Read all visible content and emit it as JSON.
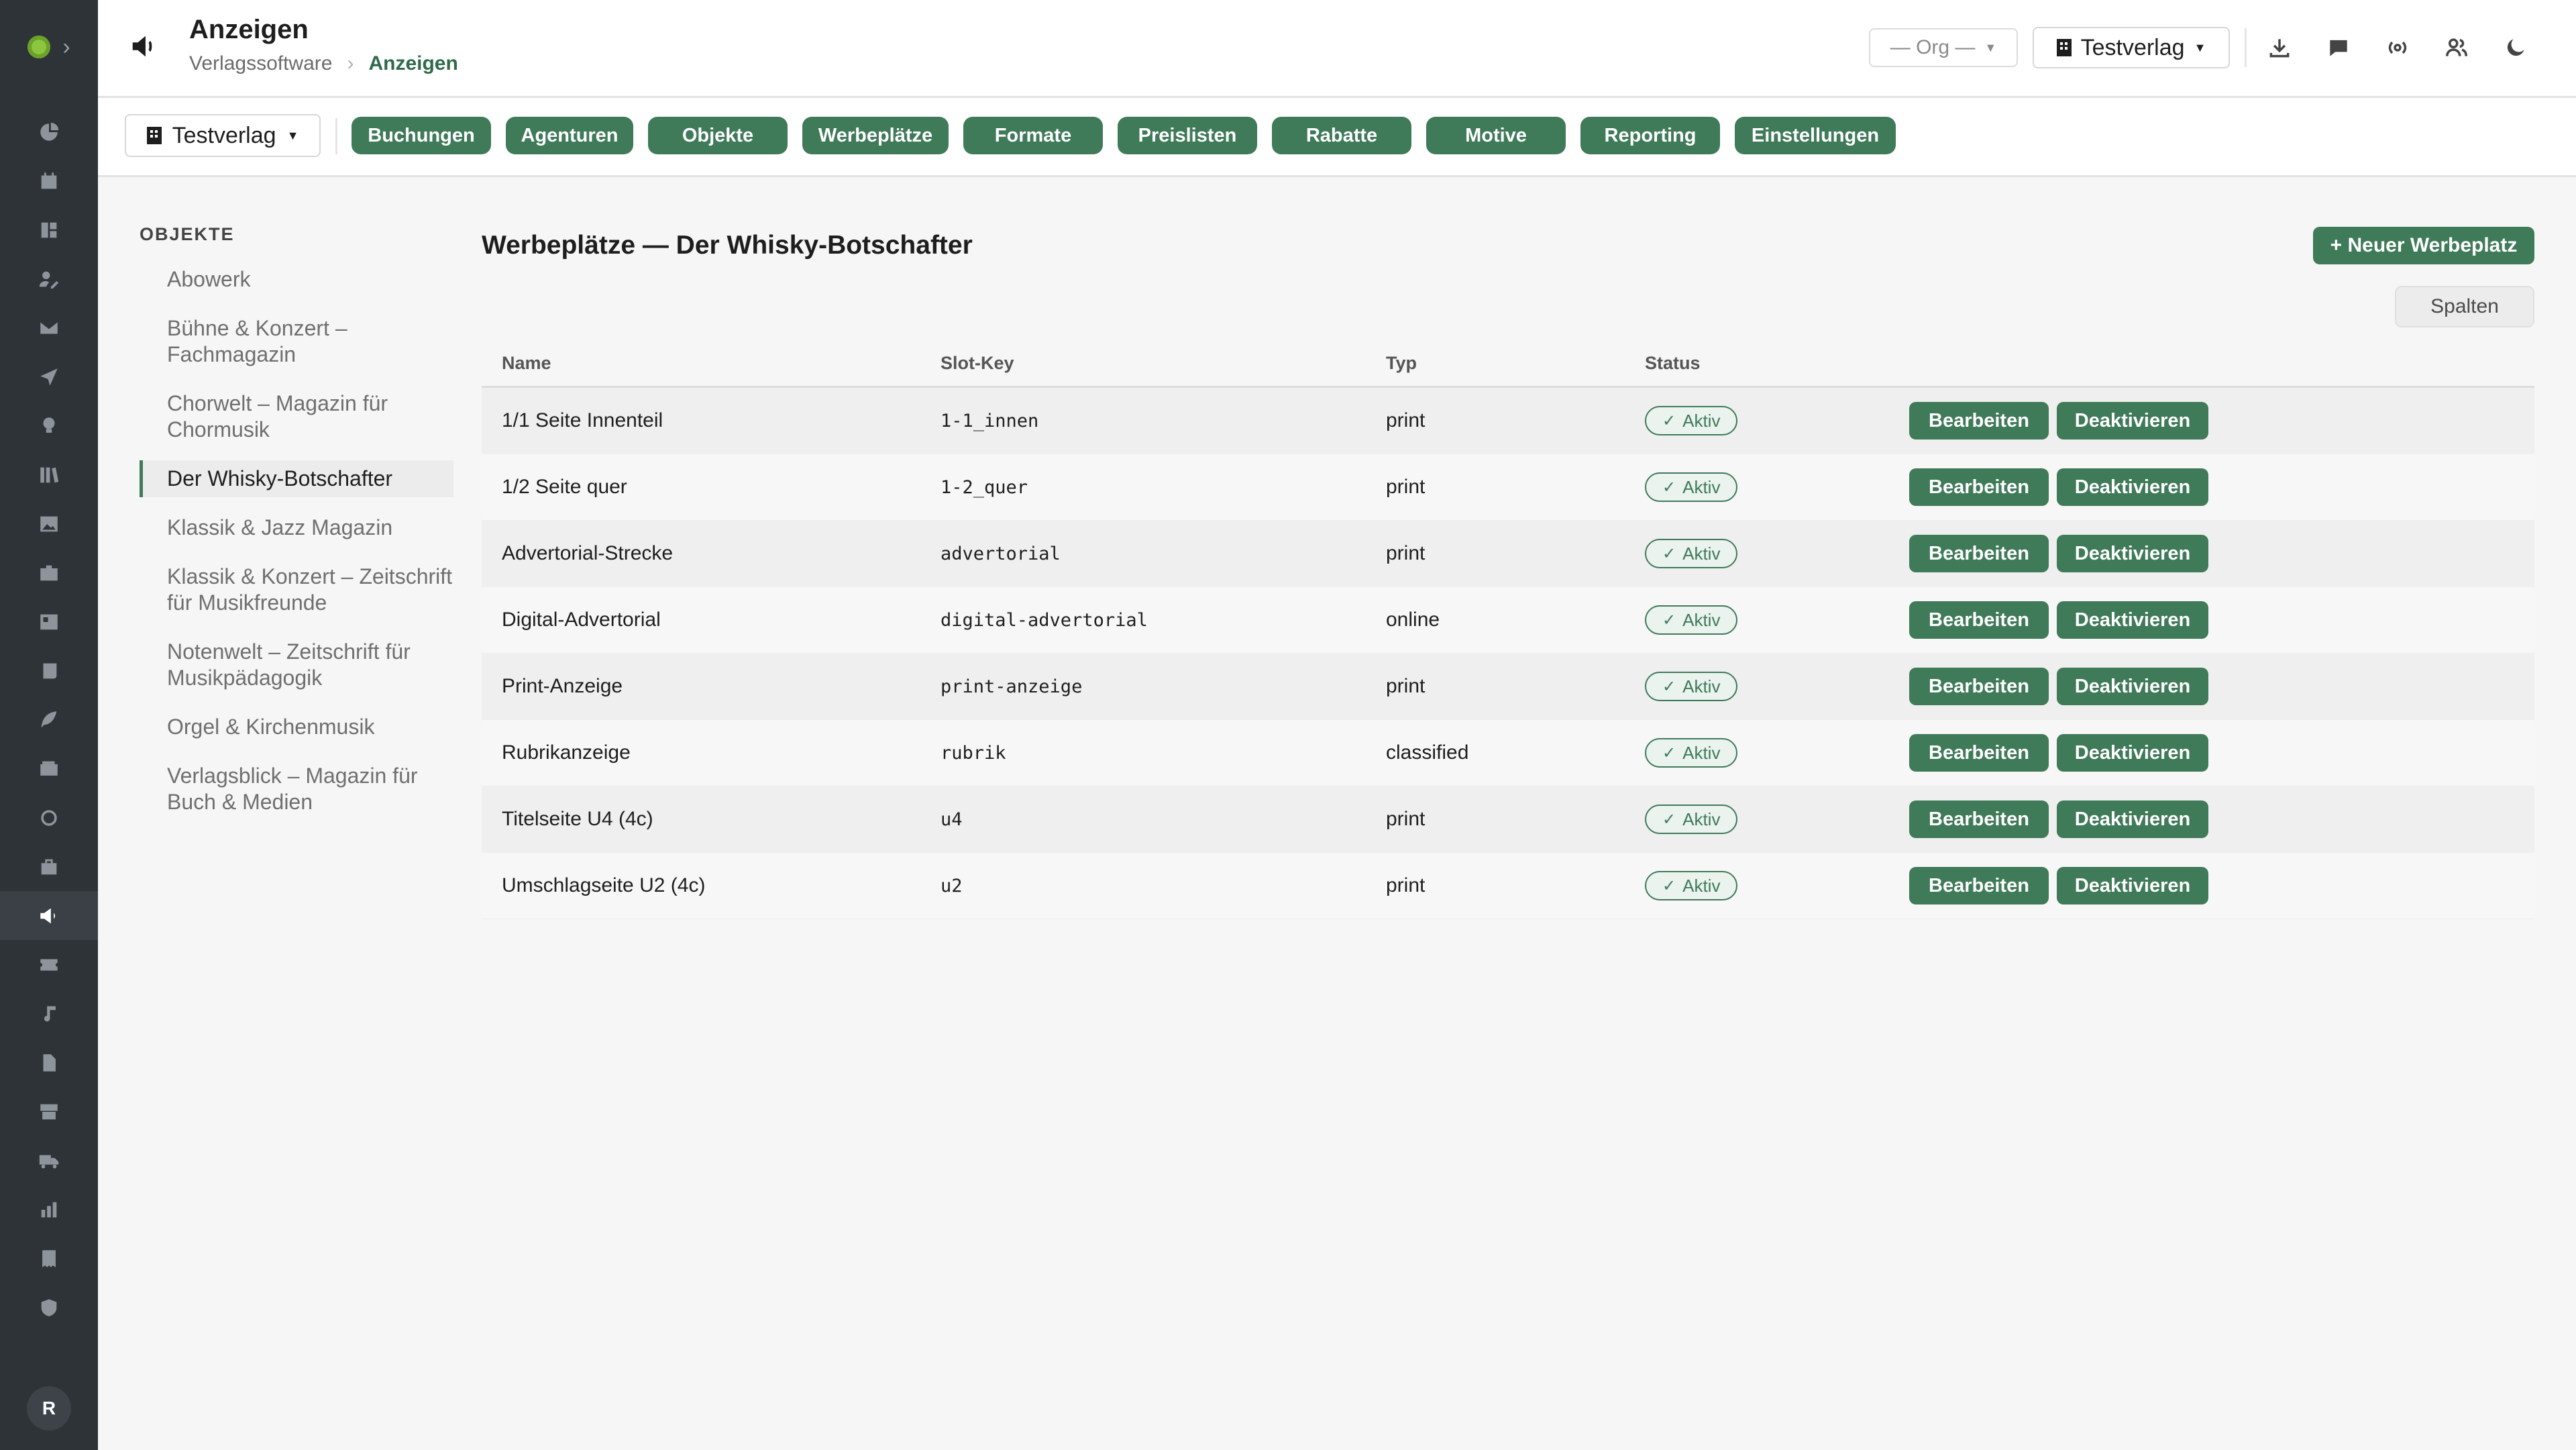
{
  "app": {
    "title": "Anzeigen",
    "breadcrumb": [
      "Verlagssoftware",
      "Anzeigen"
    ]
  },
  "header": {
    "org_select": "— Org —",
    "publisher_select": "Testverlag",
    "icons": [
      "download-icon",
      "chat-icon",
      "broadcast-icon",
      "users-icon",
      "moon-icon"
    ]
  },
  "rail": {
    "user_initial": "R",
    "icons": [
      "dashboard-icon",
      "calendar-icon",
      "board-icon",
      "user-edit-icon",
      "mail-icon",
      "send-icon",
      "lightbulb-icon",
      "library-icon",
      "image-icon",
      "briefcase-icon",
      "id-card-icon",
      "scroll-icon",
      "feather-icon",
      "wallet-icon",
      "circle-icon",
      "bag-icon",
      "megaphone-icon",
      "ticket-icon",
      "music-icon",
      "file-icon",
      "shop-icon",
      "truck-icon",
      "chart-icon",
      "receipt-icon",
      "shield-icon"
    ],
    "active_index": 16
  },
  "tabsbar": {
    "publisher": "Testverlag",
    "tabs": [
      "Buchungen",
      "Agenturen",
      "Objekte",
      "Werbeplätze",
      "Formate",
      "Preislisten",
      "Rabatte",
      "Motive",
      "Reporting",
      "Einstellungen"
    ]
  },
  "objekte": {
    "heading": "OBJEKTE",
    "items": [
      "Abowerk",
      "Bühne & Konzert – Fachmagazin",
      "Chorwelt – Magazin für Chormusik",
      "Der Whisky-Botschafter",
      "Klassik & Jazz Magazin",
      "Klassik & Konzert – Zeitschrift für Musikfreunde",
      "Notenwelt – Zeitschrift für Musikpädagogik",
      "Orgel & Kirchenmusik",
      "Verlagsblick – Magazin für Buch & Medien"
    ],
    "active_index": 3
  },
  "main": {
    "title": "Werbeplätze — Der Whisky-Botschafter",
    "new_button": "+ Neuer Werbeplatz",
    "columns_button": "Spalten",
    "table": {
      "headers": [
        "Name",
        "Slot-Key",
        "Typ",
        "Status"
      ],
      "edit_label": "Bearbeiten",
      "deactivate_label": "Deaktivieren",
      "rows": [
        {
          "name": "1/1 Seite Innenteil",
          "key": "1-1_innen",
          "typ": "print",
          "status": "Aktiv"
        },
        {
          "name": "1/2 Seite quer",
          "key": "1-2_quer",
          "typ": "print",
          "status": "Aktiv"
        },
        {
          "name": "Advertorial-Strecke",
          "key": "advertorial",
          "typ": "print",
          "status": "Aktiv"
        },
        {
          "name": "Digital-Advertorial",
          "key": "digital-advertorial",
          "typ": "online",
          "status": "Aktiv"
        },
        {
          "name": "Print-Anzeige",
          "key": "print-anzeige",
          "typ": "print",
          "status": "Aktiv"
        },
        {
          "name": "Rubrikanzeige",
          "key": "rubrik",
          "typ": "classified",
          "status": "Aktiv"
        },
        {
          "name": "Titelseite U4 (4c)",
          "key": "u4",
          "typ": "print",
          "status": "Aktiv"
        },
        {
          "name": "Umschlagseite U2 (4c)",
          "key": "u2",
          "typ": "print",
          "status": "Aktiv"
        }
      ]
    }
  },
  "colors": {
    "accent": "#3f7a59",
    "sidebar": "#2e3338",
    "background": "#f6f6f6"
  }
}
